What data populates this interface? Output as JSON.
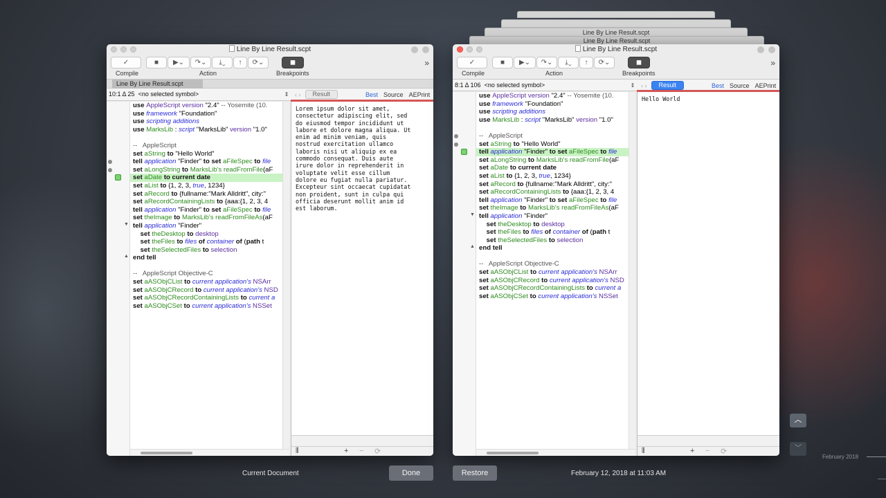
{
  "background_windows": {
    "title_top": "Line By Line Result.scpt",
    "title_mid": "Line By Line Result.scpt"
  },
  "left_window": {
    "title": "Line By Line Result.scpt",
    "toolbar": {
      "compile_label": "Compile",
      "action_label": "Action",
      "breakpoints_label": "Breakpoints"
    },
    "tab_label": "Line By Line Result.scpt",
    "nav": {
      "position": "10:1 Δ 25",
      "symbol": "<no selected symbol>"
    },
    "result_tabs": {
      "result": "Result",
      "best": "Best",
      "source": "Source",
      "aeprint": "AEPrint"
    },
    "result_text": "Lorem ipsum dolor sit amet,\nconsectetur adipiscing elit, sed\ndo eiusmod tempor incididunt ut\nlabore et dolore magna aliqua. Ut\nenim ad minim veniam, quis\nnostrud exercitation ullamco\nlaboris nisi ut aliquip ex ea\ncommodo consequat. Duis aute\nirure dolor in reprehenderit in\nvoluptate velit esse cillum\ndolore eu fugiat nulla pariatur.\nExcepteur sint occaecat cupidatat\nnon proident, sunt in culpa qui\nofficia deserunt mollit anim id\nest laborum."
  },
  "right_window": {
    "title": "Line By Line Result.scpt",
    "toolbar": {
      "compile_label": "Compile",
      "action_label": "Action",
      "breakpoints_label": "Breakpoints"
    },
    "nav": {
      "position": "8:1 Δ 106",
      "symbol": "<no selected symbol>"
    },
    "result_tabs": {
      "result": "Result",
      "best": "Best",
      "source": "Source",
      "aeprint": "AEPrint"
    },
    "result_text": "Hello World"
  },
  "code_lines": [
    {
      "parts": [
        [
          "k",
          "use "
        ],
        [
          "c",
          "AppleScript"
        ],
        [
          "c",
          " version "
        ],
        [
          "s",
          "\"2.4\" "
        ],
        [
          "cm",
          "-- Yosemite (10."
        ]
      ]
    },
    {
      "parts": [
        [
          "k",
          "use "
        ],
        [
          "i",
          "framework"
        ],
        [
          "s",
          " \"Foundation\""
        ]
      ]
    },
    {
      "parts": [
        [
          "k",
          "use "
        ],
        [
          "i",
          "scripting additions"
        ]
      ]
    },
    {
      "parts": [
        [
          "k",
          "use "
        ],
        [
          "g",
          "MarksLib"
        ],
        [
          "s",
          " : "
        ],
        [
          "i",
          "script"
        ],
        [
          "s",
          " \"MarksLib\" "
        ],
        [
          "c",
          "version"
        ],
        [
          "s",
          " \"1.0\""
        ]
      ]
    },
    {
      "parts": [
        [
          "s",
          ""
        ]
      ]
    },
    {
      "parts": [
        [
          "cm",
          "--   AppleScript"
        ]
      ]
    },
    {
      "parts": [
        [
          "k",
          "set "
        ],
        [
          "g",
          "aString"
        ],
        [
          "k",
          " to "
        ],
        [
          "s",
          "\"Hello World\""
        ]
      ]
    },
    {
      "parts": [
        [
          "k",
          "tell "
        ],
        [
          "i",
          "application"
        ],
        [
          "s",
          " \"Finder\" "
        ],
        [
          "k",
          "to set "
        ],
        [
          "g",
          "aFileSpec"
        ],
        [
          "k",
          " to "
        ],
        [
          "i",
          "file"
        ]
      ]
    },
    {
      "parts": [
        [
          "k",
          "set "
        ],
        [
          "g",
          "aLongString"
        ],
        [
          "k",
          " to "
        ],
        [
          "g",
          "MarksLib's "
        ],
        [
          "g",
          "readFromFile"
        ],
        [
          "s",
          "(aF"
        ]
      ]
    },
    {
      "parts": [
        [
          "k",
          "set "
        ],
        [
          "g",
          "aDate"
        ],
        [
          "k",
          " to current date"
        ]
      ]
    },
    {
      "parts": [
        [
          "k",
          "set "
        ],
        [
          "g",
          "aList"
        ],
        [
          "k",
          " to "
        ],
        [
          "s",
          "{1, 2, 3, "
        ],
        [
          "i",
          "true"
        ],
        [
          "s",
          ", 1234}"
        ]
      ]
    },
    {
      "parts": [
        [
          "k",
          "set "
        ],
        [
          "g",
          "aRecord"
        ],
        [
          "k",
          " to "
        ],
        [
          "s",
          "{fullname:\"Mark Alldritt\", city:\""
        ]
      ]
    },
    {
      "parts": [
        [
          "k",
          "set "
        ],
        [
          "g",
          "aRecordContainingLists"
        ],
        [
          "k",
          " to "
        ],
        [
          "s",
          "{aaa:{1, 2, 3, 4"
        ]
      ]
    },
    {
      "parts": [
        [
          "k",
          "tell "
        ],
        [
          "i",
          "application"
        ],
        [
          "s",
          " \"Finder\" "
        ],
        [
          "k",
          "to set "
        ],
        [
          "g",
          "aFileSpec"
        ],
        [
          "k",
          " to "
        ],
        [
          "i",
          "file"
        ]
      ]
    },
    {
      "parts": [
        [
          "k",
          "set "
        ],
        [
          "g",
          "theImage"
        ],
        [
          "k",
          " to "
        ],
        [
          "g",
          "MarksLib's "
        ],
        [
          "g",
          "readFromFileAs"
        ],
        [
          "s",
          "(aF"
        ]
      ]
    },
    {
      "parts": [
        [
          "k",
          "tell "
        ],
        [
          "i",
          "application"
        ],
        [
          "s",
          " \"Finder\""
        ]
      ]
    },
    {
      "parts": [
        [
          "s",
          "    "
        ],
        [
          "k",
          "set "
        ],
        [
          "g",
          "theDesktop"
        ],
        [
          "k",
          " to "
        ],
        [
          "c",
          "desktop"
        ]
      ]
    },
    {
      "parts": [
        [
          "s",
          "    "
        ],
        [
          "k",
          "set "
        ],
        [
          "g",
          "theFiles"
        ],
        [
          "k",
          " to "
        ],
        [
          "i",
          "files"
        ],
        [
          "k",
          " of "
        ],
        [
          "i",
          "container"
        ],
        [
          "k",
          " of "
        ],
        [
          "s",
          "("
        ],
        [
          "k",
          "path"
        ],
        [
          "s",
          " t"
        ]
      ]
    },
    {
      "parts": [
        [
          "s",
          "    "
        ],
        [
          "k",
          "set "
        ],
        [
          "g",
          "theSelectedFiles"
        ],
        [
          "k",
          " to "
        ],
        [
          "c",
          "selection"
        ]
      ]
    },
    {
      "parts": [
        [
          "k",
          "end tell"
        ]
      ]
    },
    {
      "parts": [
        [
          "s",
          ""
        ]
      ]
    },
    {
      "parts": [
        [
          "cm",
          "--   AppleScript Objective-C"
        ]
      ]
    },
    {
      "parts": [
        [
          "k",
          "set "
        ],
        [
          "g",
          "aASObjCList"
        ],
        [
          "k",
          " to "
        ],
        [
          "i",
          "current application's"
        ],
        [
          "c",
          " NSArr"
        ]
      ]
    },
    {
      "parts": [
        [
          "k",
          "set "
        ],
        [
          "g",
          "aASObjCRecord"
        ],
        [
          "k",
          " to "
        ],
        [
          "i",
          "current application's"
        ],
        [
          "c",
          " NSD"
        ]
      ]
    },
    {
      "parts": [
        [
          "k",
          "set "
        ],
        [
          "g",
          "aASObjCRecordContainingLists"
        ],
        [
          "k",
          " to "
        ],
        [
          "i",
          "current a"
        ]
      ]
    },
    {
      "parts": [
        [
          "k",
          "set "
        ],
        [
          "g",
          "aASObjCSet"
        ],
        [
          "k",
          " to "
        ],
        [
          "i",
          "current application's"
        ],
        [
          "c",
          " NSSet"
        ]
      ]
    }
  ],
  "left_highlight_line": 9,
  "right_highlight_line": 7,
  "bottom": {
    "current_document": "Current Document",
    "done": "Done",
    "restore": "Restore",
    "timestamp": "February 12, 2018 at 11:03 AM",
    "timeline_label": "February 2018"
  },
  "colors": {
    "highlight": "#c9f3c4",
    "result_active": "#3a83f2",
    "close_red": "#fc5f57"
  }
}
